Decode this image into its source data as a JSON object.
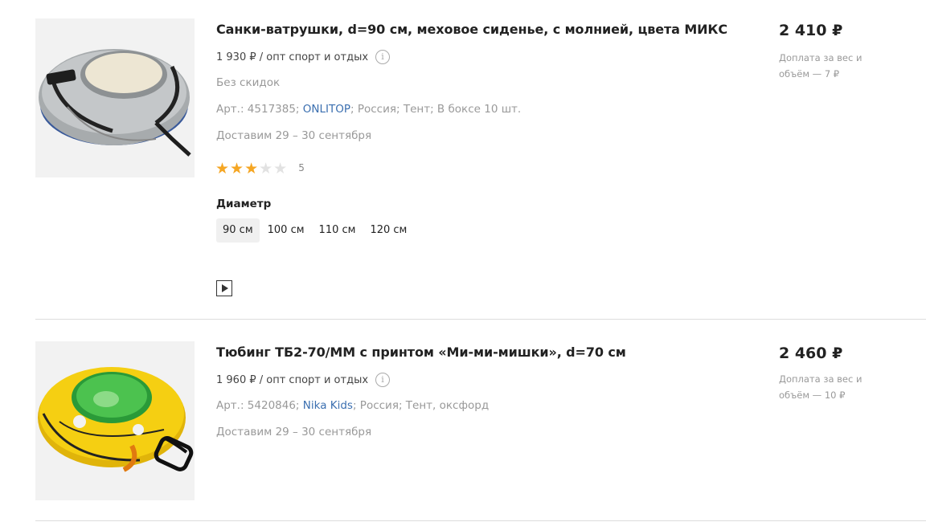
{
  "products": [
    {
      "title": "Санки-ватрушки, d=90 см, меховое сиденье, с молнией, цвета МИКС",
      "opt_price": "1 930 ₽ / опт спорт и отдых",
      "info_icon": "i",
      "discount": "Без скидок",
      "art_prefix": "Арт.: 4517385; ",
      "brand": "ONLITOP",
      "art_suffix": "; Россия; Тент; В боксе 10 шт.",
      "delivery": "Доставим 29 – 30 сентября",
      "rating": 3,
      "stars_on": "★★★",
      "stars_off": "★★",
      "reviews_count": "5",
      "option_label": "Диаметр",
      "options": [
        "90 см",
        "100 см",
        "110 см",
        "120 см"
      ],
      "selected_option": "90 см",
      "price": "2 410 ₽",
      "price_note": "Доплата за вес и объём — 7 ₽",
      "image_icon": "snow-tube-gray-image"
    },
    {
      "title": "Тюбинг ТБ2-70/ММ с принтом «Ми-ми-мишки», d=70 см",
      "opt_price": "1 960 ₽ / опт спорт и отдых",
      "info_icon": "i",
      "art_prefix": "Арт.: 5420846; ",
      "brand": "Nika Kids",
      "art_suffix": "; Россия; Тент, оксфорд",
      "delivery": "Доставим 29 – 30 сентября",
      "price": "2 460 ₽",
      "price_note": "Доплата за вес и объём — 10 ₽",
      "image_icon": "snow-tube-yellow-image"
    }
  ],
  "colors": {
    "star_on": "#f5a623",
    "star_off": "#e2e2e2",
    "link": "#3b6fb0",
    "muted": "#999999"
  }
}
